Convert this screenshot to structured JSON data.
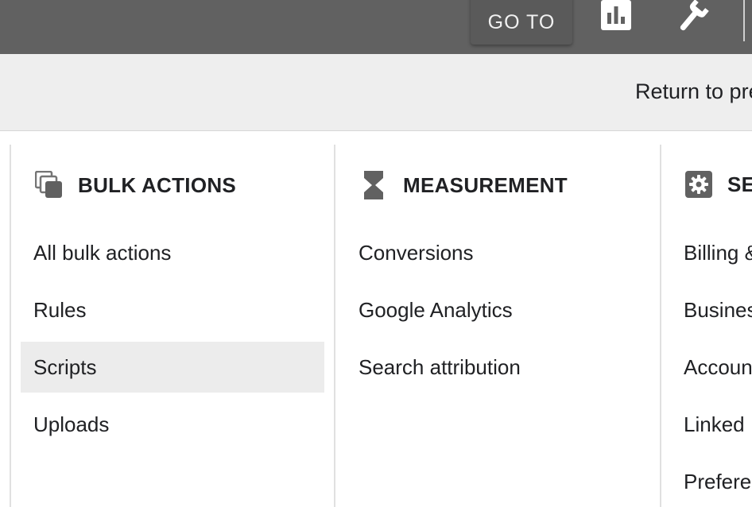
{
  "topbar": {
    "goto_label": "GO TO",
    "reports_icon": "bar-chart-icon",
    "tools_icon": "wrench-icon",
    "background": "#616161"
  },
  "subbar": {
    "return_link": "Return to pre"
  },
  "columns": [
    {
      "title": "BULK ACTIONS",
      "icon": "bulk-actions-icon",
      "items": [
        {
          "label": "All bulk actions",
          "selected": false
        },
        {
          "label": "Rules",
          "selected": false
        },
        {
          "label": "Scripts",
          "selected": true
        },
        {
          "label": "Uploads",
          "selected": false
        }
      ]
    },
    {
      "title": "MEASUREMENT",
      "icon": "hourglass-icon",
      "items": [
        {
          "label": "Conversions",
          "selected": false
        },
        {
          "label": "Google Analytics",
          "selected": false
        },
        {
          "label": "Search attribution",
          "selected": false
        }
      ]
    },
    {
      "title": "SE",
      "icon": "settings-gear-icon",
      "items": [
        {
          "label": "Billing &",
          "selected": false
        },
        {
          "label": "Busines",
          "selected": false
        },
        {
          "label": "Accoun",
          "selected": false
        },
        {
          "label": "Linked",
          "selected": false
        },
        {
          "label": "Prefere",
          "selected": false
        }
      ]
    }
  ],
  "colors": {
    "selected_background": "#ececec",
    "subbar_background": "#eeeeee",
    "icon_gray": "#616161"
  }
}
